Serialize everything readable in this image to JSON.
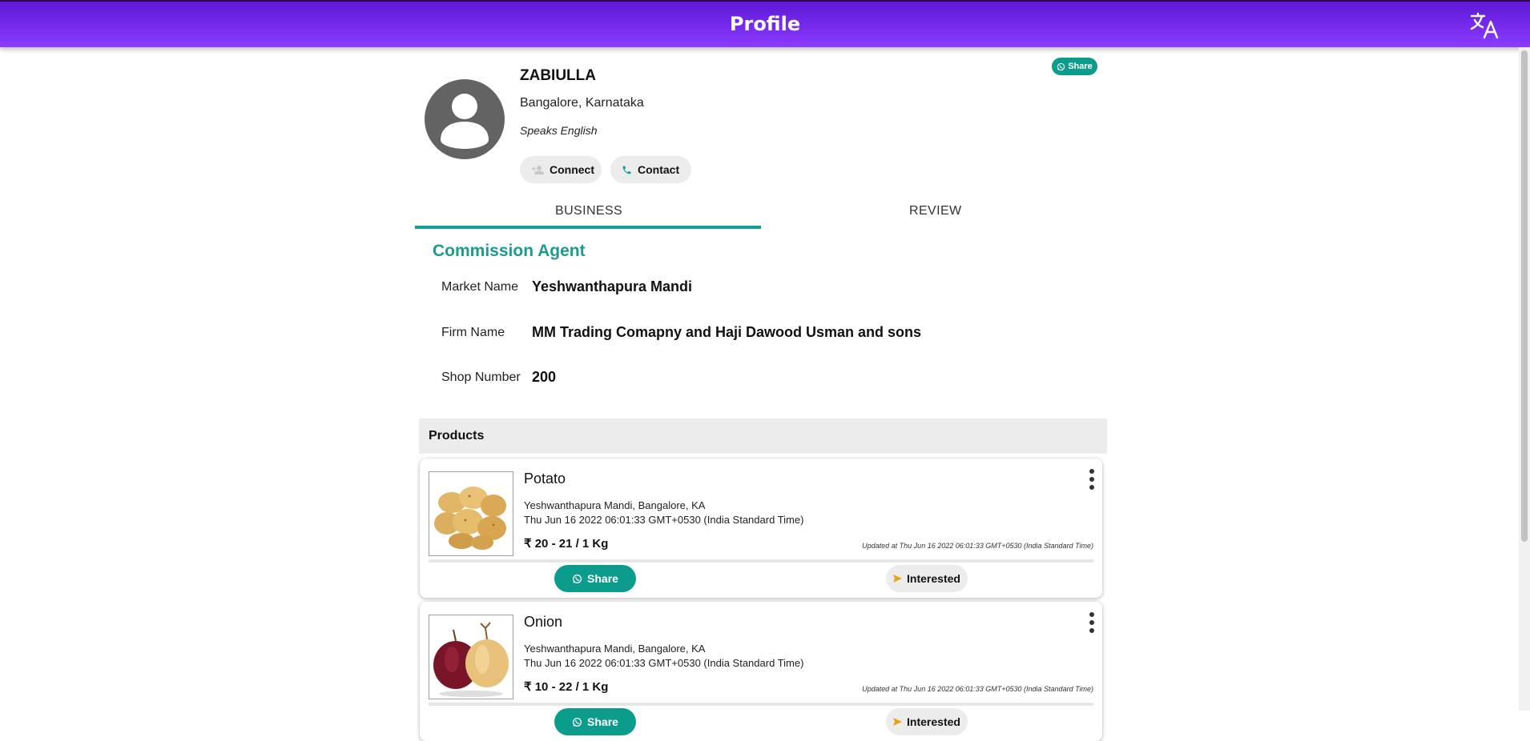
{
  "header": {
    "title": "Profile",
    "translate_icon": "translate-icon"
  },
  "profile": {
    "name": "ZABIULLA",
    "location": "Bangalore, Karnataka",
    "language": "Speaks English",
    "connect_label": "Connect",
    "contact_label": "Contact",
    "share_label": "Share"
  },
  "tabs": [
    {
      "label": "BUSINESS",
      "active": true
    },
    {
      "label": "REVIEW",
      "active": false
    }
  ],
  "business": {
    "role": "Commission Agent",
    "fields": [
      {
        "label": "Market Name",
        "value": "Yeshwanthapura Mandi"
      },
      {
        "label": "Firm Name",
        "value": "MM Trading Comapny and Haji Dawood Usman and sons"
      },
      {
        "label": "Shop Number",
        "value": "200"
      }
    ]
  },
  "products": {
    "heading": "Products",
    "items": [
      {
        "name": "Potato",
        "market": "Yeshwanthapura Mandi, Bangalore, KA",
        "date": "Thu Jun 16 2022 06:01:33 GMT+0530 (India Standard Time)",
        "price": "₹ 20 - 21 / 1 Kg",
        "updated": "Updated at Thu Jun 16 2022 06:01:33 GMT+0530 (India Standard Time)",
        "share_label": "Share",
        "interested_label": "Interested"
      },
      {
        "name": "Onion",
        "market": "Yeshwanthapura Mandi, Bangalore, KA",
        "date": "Thu Jun 16 2022 06:01:33 GMT+0530 (India Standard Time)",
        "price": "₹ 10 - 22 / 1 Kg",
        "updated": "Updated at Thu Jun 16 2022 06:01:33 GMT+0530 (India Standard Time)",
        "share_label": "Share",
        "interested_label": "Interested"
      }
    ]
  },
  "colors": {
    "header_gradient_start": "#5e18d6",
    "header_gradient_end": "#8b3cff",
    "accent_teal": "#0b9c8c",
    "pill_grey": "#ececec"
  }
}
